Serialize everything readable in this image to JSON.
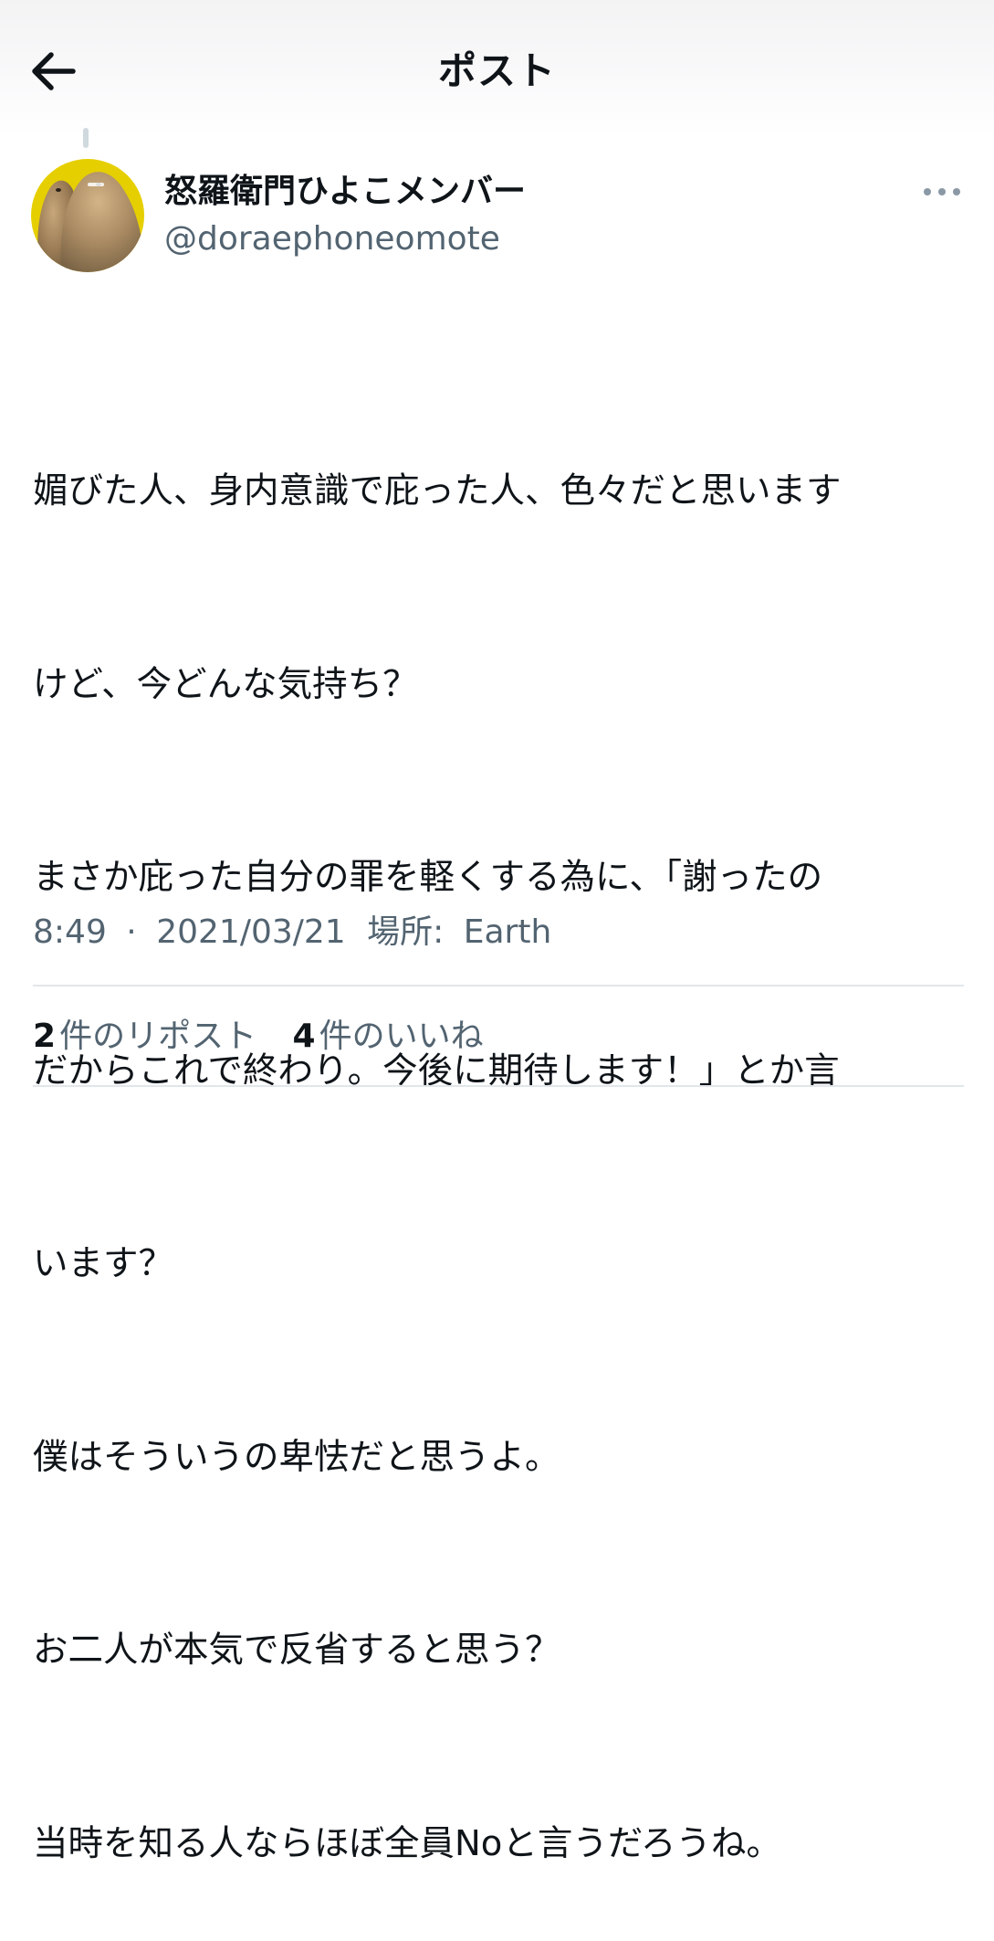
{
  "header": {
    "title": "ポスト",
    "back_icon": "arrow-left-icon"
  },
  "author": {
    "display_name": "怒羅衛門ひよこメンバー",
    "handle": "@doraephoneomote",
    "avatar_icon": "avatar-image"
  },
  "more_icon": "more-options-icon",
  "tweet": {
    "lines": [
      "媚びた人、身内意識で庇った人、色々だと思います",
      "けど、今どんな気持ち？",
      "まさか庇った自分の罪を軽くする為に、「謝ったの",
      "だからこれで終わり。今後に期待します！」とか言",
      "います？",
      "僕はそういうの卑怯だと思うよ。",
      "お二人が本気で反省すると思う？",
      "当時を知る人ならほぼ全員Noと言うだろうね。"
    ]
  },
  "meta": {
    "time": "8:49",
    "separator": "·",
    "date": "2021/03/21",
    "location_label": "場所:",
    "location": "Earth"
  },
  "stats": {
    "reposts_count": "2",
    "reposts_label": "件のリポスト",
    "likes_count": "4",
    "likes_label": "件のいいね"
  },
  "colors": {
    "text": "#0f1419",
    "secondary": "#536471",
    "divider": "#e1e6ea",
    "avatar_bg": "#e6cf00"
  }
}
